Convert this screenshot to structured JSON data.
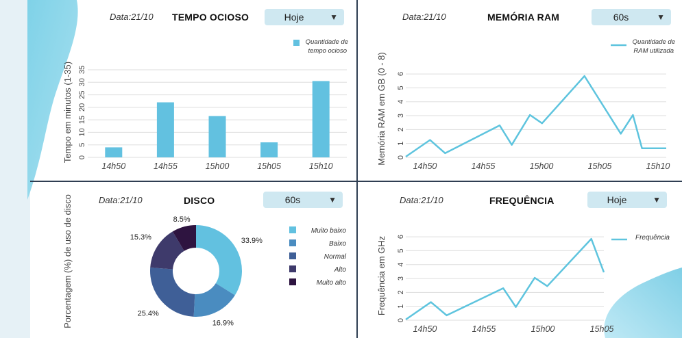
{
  "panels": {
    "idle": {
      "date": "Data:21/10",
      "title": "TEMPO OCIOSO",
      "select_value": "Hoje",
      "legend": [
        "Quantidade de",
        "tempo ocioso"
      ],
      "ylabel": "Tempo em minutos (1-35)"
    },
    "ram": {
      "date": "Data:21/10",
      "title": "MEMÓRIA RAM",
      "select_value": "60s",
      "legend": [
        "Quantidade de",
        "RAM utilizada"
      ],
      "ylabel": "Memória RAM em GB (0 - 8)"
    },
    "disk": {
      "date": "Data:21/10",
      "title": "DISCO",
      "select_value": "60s",
      "ylabel": "Porcentagem (%) de uso de disco"
    },
    "freq": {
      "date": "Data:21/10",
      "title": "FREQUÊNCIA",
      "select_value": "Hoje",
      "legend": "Frequência",
      "ylabel": "Frequência em GHz"
    }
  },
  "colors": {
    "bar": "#62c1e0",
    "line": "#5ec4de",
    "grid": "#dddddd",
    "axis_text": "#444444",
    "donut": [
      "#62c1e0",
      "#4a8cc0",
      "#3f5f97",
      "#3e3a6b",
      "#2e1440"
    ]
  },
  "icons": {
    "dropdown": "triangle-down-icon"
  },
  "chart_data": [
    {
      "type": "bar",
      "title": "TEMPO OCIOSO",
      "ylabel": "Tempo em minutos (1-35)",
      "xlabel": "",
      "categories": [
        "14h50",
        "14h55",
        "15h00",
        "15h05",
        "15h10"
      ],
      "yticks": [
        0,
        5,
        10,
        15,
        20,
        25,
        30,
        35
      ],
      "ylim": [
        0,
        35
      ],
      "series": [
        {
          "name": "Quantidade de tempo ocioso",
          "values": [
            4,
            22,
            16.5,
            6,
            30.5
          ]
        }
      ],
      "grid": true,
      "legend_position": "top-right"
    },
    {
      "type": "line",
      "title": "MEMÓRIA RAM",
      "ylabel": "Memória RAM em GB (0 - 8)",
      "xlabel": "",
      "x_ticks": [
        "14h50",
        "14h55",
        "15h00",
        "15h05",
        "15h10"
      ],
      "yticks": [
        0,
        1,
        2,
        3,
        4,
        5,
        6
      ],
      "ylim": [
        0,
        6.2
      ],
      "x": [
        0,
        0.8,
        1.3,
        3.1,
        3.5,
        4.1,
        4.5,
        5.9,
        7.1,
        7.5,
        7.8,
        8.6
      ],
      "series": [
        {
          "name": "Quantidade de RAM utilizada",
          "values": [
            0.05,
            1.25,
            0.3,
            2.3,
            0.9,
            3.05,
            2.45,
            5.85,
            1.7,
            3.05,
            0.65,
            0.65
          ]
        }
      ],
      "grid": true,
      "legend_position": "top-right"
    },
    {
      "type": "pie",
      "title": "DISCO",
      "categories": [
        "Muito baixo",
        "Baixo",
        "Normal",
        "Alto",
        "Muito alto"
      ],
      "values": [
        33.9,
        16.9,
        25.4,
        15.3,
        8.5
      ],
      "labels": [
        "33.9%",
        "16.9%",
        "25.4%",
        "15.3%",
        "8.5%"
      ],
      "donut": true,
      "legend_position": "right"
    },
    {
      "type": "line",
      "title": "FREQUÊNCIA",
      "ylabel": "Frequência em GHz",
      "xlabel": "",
      "x_ticks": [
        "14h50",
        "14h55",
        "15h00",
        "15h05"
      ],
      "yticks": [
        0,
        1,
        2,
        3,
        4,
        5,
        6
      ],
      "ylim": [
        0,
        6.2
      ],
      "x": [
        0,
        0.8,
        1.3,
        3.1,
        3.5,
        4.1,
        4.5,
        5.9,
        6.3
      ],
      "series": [
        {
          "name": "Frequência",
          "values": [
            0.05,
            1.3,
            0.35,
            2.3,
            0.95,
            3.05,
            2.45,
            5.85,
            3.45
          ]
        }
      ],
      "grid": true,
      "legend_position": "top-right"
    }
  ]
}
